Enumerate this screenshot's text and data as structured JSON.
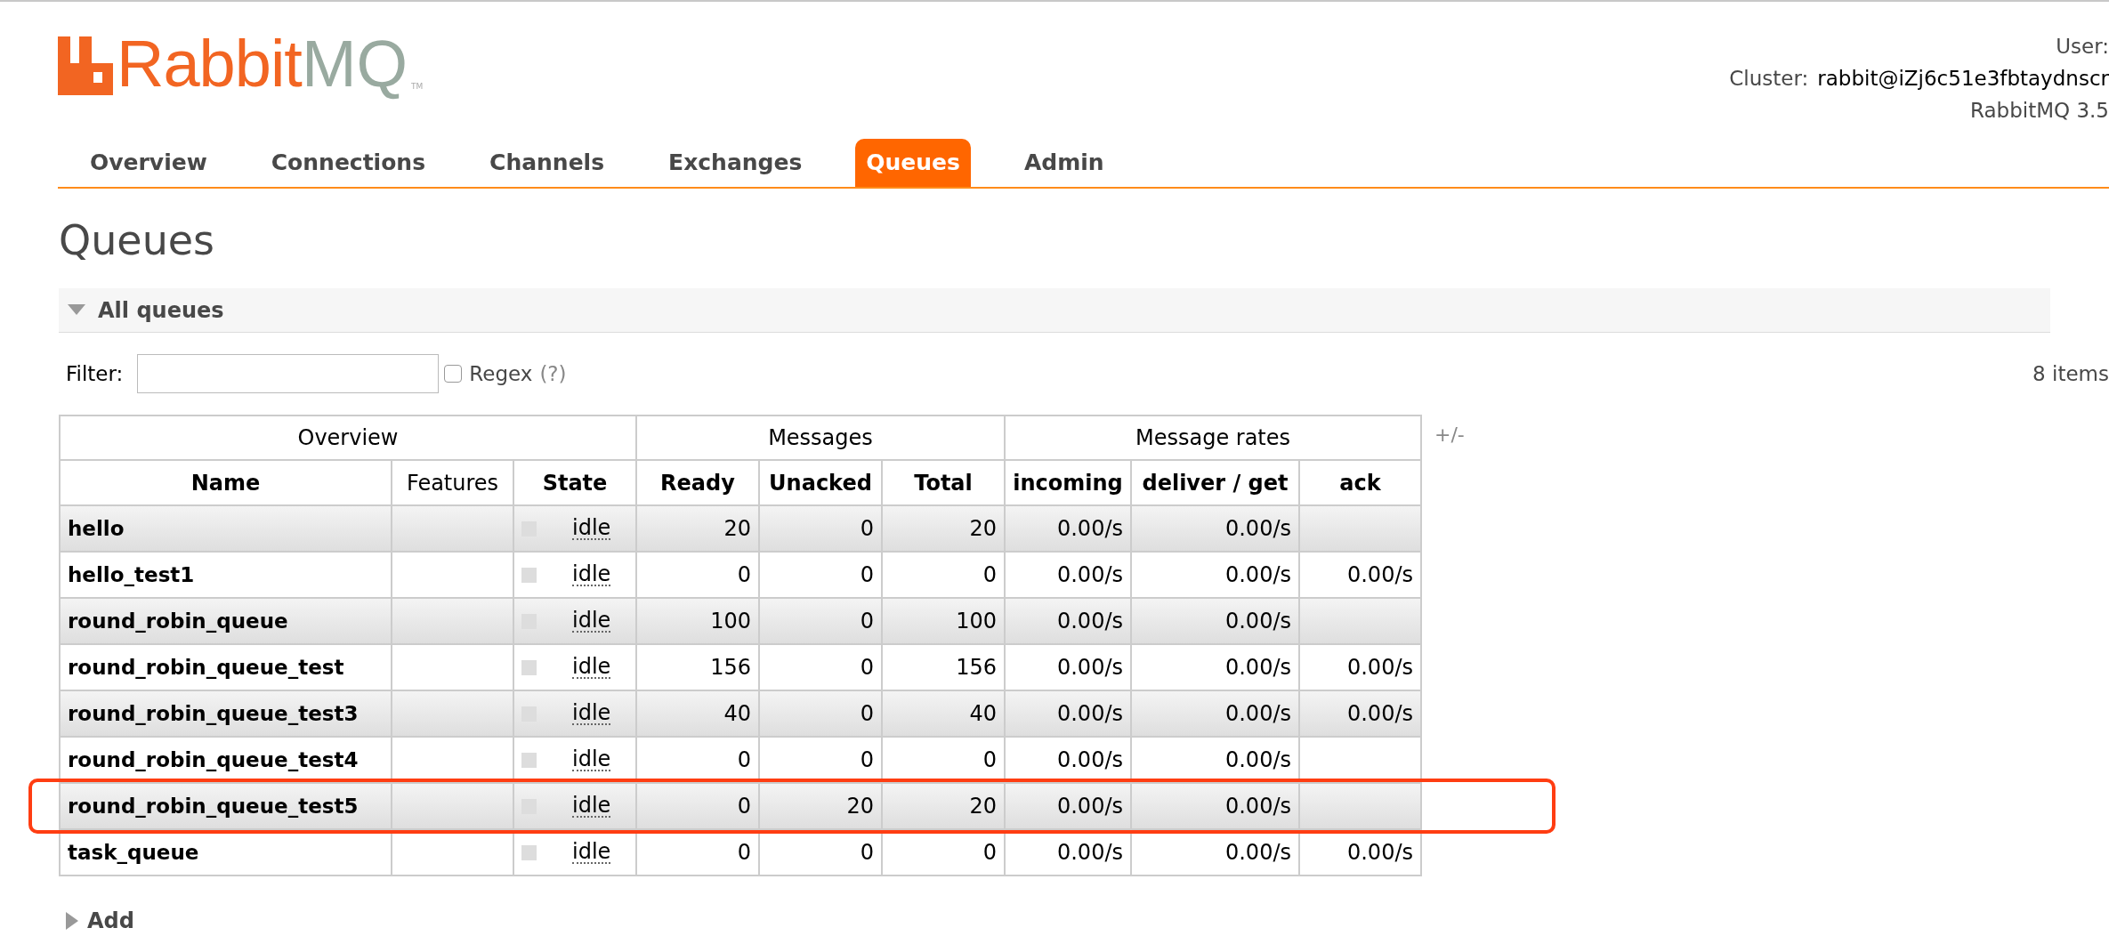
{
  "logo": {
    "text_primary": "Rabbit",
    "text_secondary": "MQ",
    "trademark": "TM"
  },
  "header_info": {
    "user_label": "User:",
    "cluster_label": "Cluster:",
    "cluster_value": "rabbit@iZj6c51e3fbtaydnscr",
    "version": "RabbitMQ 3.5"
  },
  "tabs": [
    {
      "label": "Overview",
      "selected": false
    },
    {
      "label": "Connections",
      "selected": false
    },
    {
      "label": "Channels",
      "selected": false
    },
    {
      "label": "Exchanges",
      "selected": false
    },
    {
      "label": "Queues",
      "selected": true
    },
    {
      "label": "Admin",
      "selected": false
    }
  ],
  "page_title": "Queues",
  "section": {
    "title": "All queues",
    "expanded": true
  },
  "filter": {
    "label": "Filter:",
    "regex_label": "Regex",
    "regex_checked": false,
    "help": "(?)",
    "count": "8 items"
  },
  "table": {
    "groups": [
      {
        "label": "Overview"
      },
      {
        "label": "Messages"
      },
      {
        "label": "Message rates"
      }
    ],
    "toggle": "+/-",
    "columns": [
      "Name",
      "Features",
      "State",
      "Ready",
      "Unacked",
      "Total",
      "incoming",
      "deliver / get",
      "ack"
    ],
    "rows": [
      {
        "name": "hello",
        "state": "idle",
        "ready": "20",
        "unacked": "0",
        "total": "20",
        "incoming": "0.00/s",
        "deliver_get": "0.00/s",
        "highlighted": false
      },
      {
        "name": "hello_test1",
        "state": "idle",
        "ready": "0",
        "unacked": "0",
        "total": "0",
        "incoming": "0.00/s",
        "deliver_get": "0.00/s",
        "ack": "0.00/s",
        "highlighted": false
      },
      {
        "name": "round_robin_queue",
        "state": "idle",
        "ready": "100",
        "unacked": "0",
        "total": "100",
        "incoming": "0.00/s",
        "deliver_get": "0.00/s",
        "highlighted": false
      },
      {
        "name": "round_robin_queue_test",
        "state": "idle",
        "ready": "156",
        "unacked": "0",
        "total": "156",
        "incoming": "0.00/s",
        "deliver_get": "0.00/s",
        "ack": "0.00/s",
        "highlighted": false
      },
      {
        "name": "round_robin_queue_test3",
        "state": "idle",
        "ready": "40",
        "unacked": "0",
        "total": "40",
        "incoming": "0.00/s",
        "deliver_get": "0.00/s",
        "ack": "0.00/s",
        "highlighted": false
      },
      {
        "name": "round_robin_queue_test4",
        "state": "idle",
        "ready": "0",
        "unacked": "0",
        "total": "0",
        "incoming": "0.00/s",
        "deliver_get": "0.00/s",
        "highlighted": false
      },
      {
        "name": "round_robin_queue_test5",
        "state": "idle",
        "ready": "0",
        "unacked": "20",
        "total": "20",
        "incoming": "0.00/s",
        "deliver_get": "0.00/s",
        "highlighted": true
      },
      {
        "name": "task_queue",
        "state": "idle",
        "ready": "0",
        "unacked": "0",
        "total": "0",
        "incoming": "0.00/s",
        "deliver_get": "0.00/s",
        "ack": "0.00/s",
        "highlighted": false
      }
    ]
  },
  "next_section": {
    "title": "Add"
  }
}
